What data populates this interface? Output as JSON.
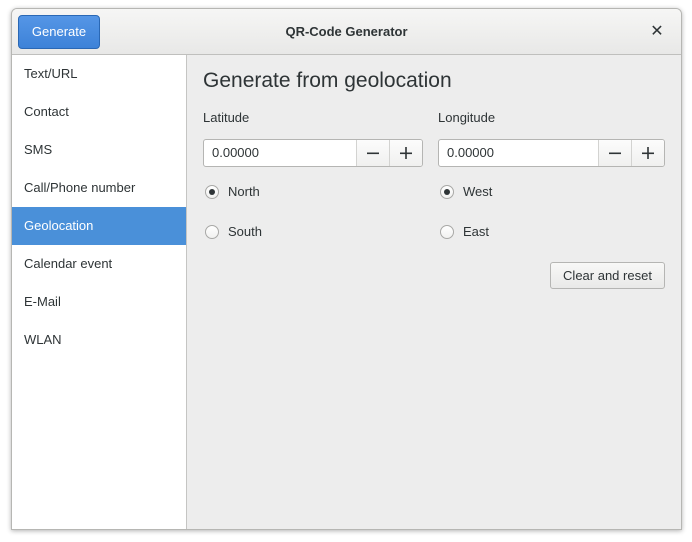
{
  "header": {
    "title": "QR-Code Generator",
    "generate_label": "Generate",
    "close_glyph": "✕",
    "close_icon": "close-icon"
  },
  "sidebar": {
    "items": [
      {
        "label": "Text/URL",
        "selected": false
      },
      {
        "label": "Contact",
        "selected": false
      },
      {
        "label": "SMS",
        "selected": false
      },
      {
        "label": "Call/Phone number",
        "selected": false
      },
      {
        "label": "Geolocation",
        "selected": true
      },
      {
        "label": "Calendar event",
        "selected": false
      },
      {
        "label": "E-Mail",
        "selected": false
      },
      {
        "label": "WLAN",
        "selected": false
      }
    ]
  },
  "main": {
    "heading": "Generate from geolocation",
    "latitude": {
      "label": "Latitude",
      "value": "0.00000",
      "options": [
        {
          "label": "North",
          "checked": true
        },
        {
          "label": "South",
          "checked": false
        }
      ]
    },
    "longitude": {
      "label": "Longitude",
      "value": "0.00000",
      "options": [
        {
          "label": "West",
          "checked": true
        },
        {
          "label": "East",
          "checked": false
        }
      ]
    },
    "clear_label": "Clear and reset"
  },
  "colors": {
    "accent": "#4a90d9",
    "window_bg": "#ededed",
    "text": "#2e3436"
  }
}
